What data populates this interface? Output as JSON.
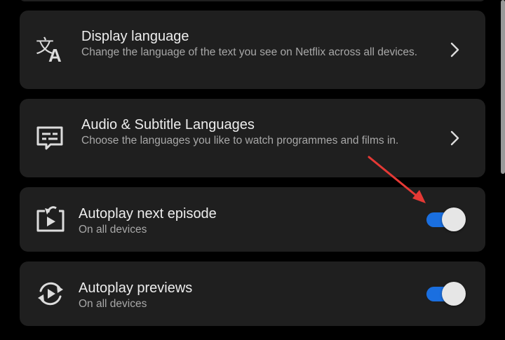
{
  "settings": [
    {
      "icon": "translate-icon",
      "title": "Display language",
      "subtitle": "Change the language of the text you see on Netflix across all devices.",
      "control": "chevron"
    },
    {
      "icon": "subtitles-icon",
      "title": "Audio & Subtitle Languages",
      "subtitle": "Choose the languages you like to watch programmes and films in.",
      "control": "chevron"
    },
    {
      "icon": "autoplay-next-icon",
      "title": "Autoplay next episode",
      "subtitle": "On all devices",
      "control": "toggle",
      "enabled": true
    },
    {
      "icon": "autoplay-previews-icon",
      "title": "Autoplay previews",
      "subtitle": "On all devices",
      "control": "toggle",
      "enabled": true
    }
  ],
  "colors": {
    "background": "#000000",
    "card": "#1f1f1f",
    "toggle_on": "#1a6fe0",
    "annotation_arrow": "#e53935"
  }
}
